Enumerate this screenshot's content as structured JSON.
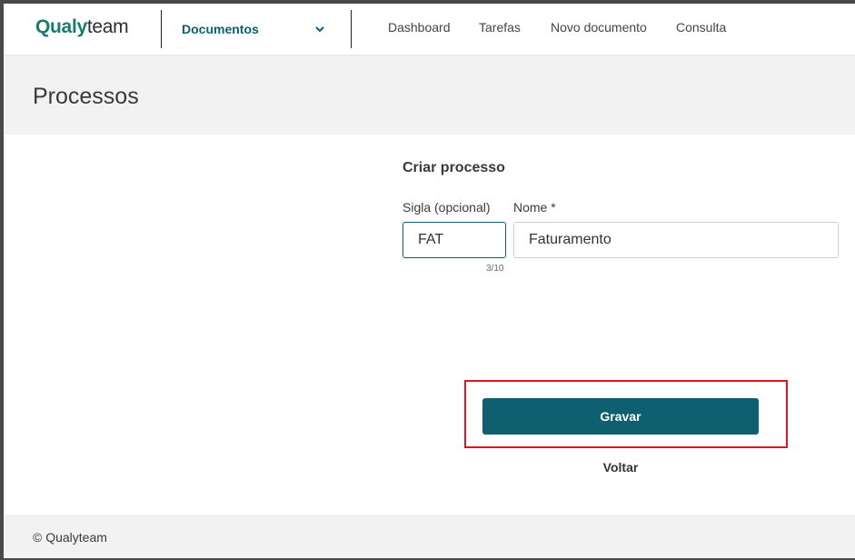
{
  "header": {
    "logo_primary": "Qualy",
    "logo_secondary": "team",
    "module_select": {
      "selected": "Documentos"
    },
    "nav": [
      {
        "label": "Dashboard"
      },
      {
        "label": "Tarefas"
      },
      {
        "label": "Novo documento"
      },
      {
        "label": "Consulta"
      }
    ]
  },
  "page": {
    "title": "Processos"
  },
  "form": {
    "title": "Criar processo",
    "sigla": {
      "label": "Sigla (opcional)",
      "value": "FAT",
      "counter": "3/10"
    },
    "nome": {
      "label": "Nome *",
      "value": "Faturamento"
    },
    "submit_label": "Gravar",
    "back_label": "Voltar"
  },
  "footer": {
    "text": "© Qualyteam"
  },
  "colors": {
    "brand": "#1a7a6d",
    "primary": "#0e5f70",
    "highlight": "#e0161e"
  },
  "icons": {
    "module_dropdown": "chevron-down-icon"
  }
}
